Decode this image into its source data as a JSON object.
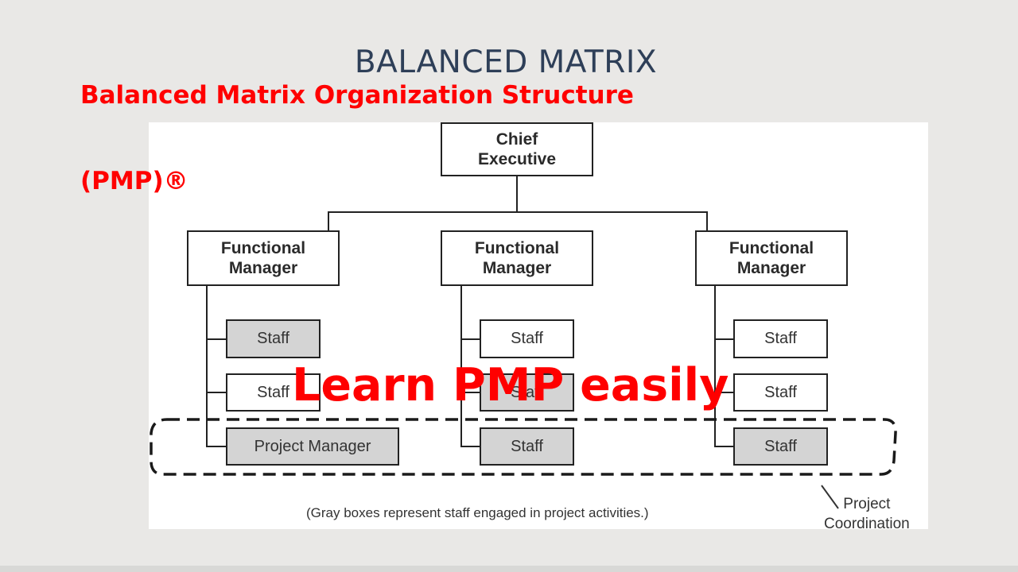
{
  "slide": {
    "title": "BALANCED MATRIX"
  },
  "overlay": {
    "title_line1": "Balanced Matrix Organization Structure",
    "title_line2": "(PMP)®",
    "watermark": "Learn PMP easily"
  },
  "diagram": {
    "chief": "Chief\nExecutive",
    "columns": [
      {
        "manager": "Functional\nManager",
        "staff": [
          {
            "label": "Staff",
            "gray": true
          },
          {
            "label": "Staff",
            "gray": false
          },
          {
            "label": "Project Manager",
            "gray": true
          }
        ]
      },
      {
        "manager": "Functional\nManager",
        "staff": [
          {
            "label": "Staff",
            "gray": false
          },
          {
            "label": "Staff",
            "gray": true
          },
          {
            "label": "Staff",
            "gray": true
          }
        ]
      },
      {
        "manager": "Functional\nManager",
        "staff": [
          {
            "label": "Staff",
            "gray": false
          },
          {
            "label": "Staff",
            "gray": false
          },
          {
            "label": "Staff",
            "gray": true
          }
        ]
      }
    ],
    "caption": "(Gray boxes represent staff engaged in project activities.)",
    "coordination_label": "Project\nCoordination"
  },
  "colors": {
    "gray_box": "#d4d4d4",
    "white_box": "#ffffff",
    "red_text": "#ff0000",
    "title_text": "#2e3f58"
  }
}
